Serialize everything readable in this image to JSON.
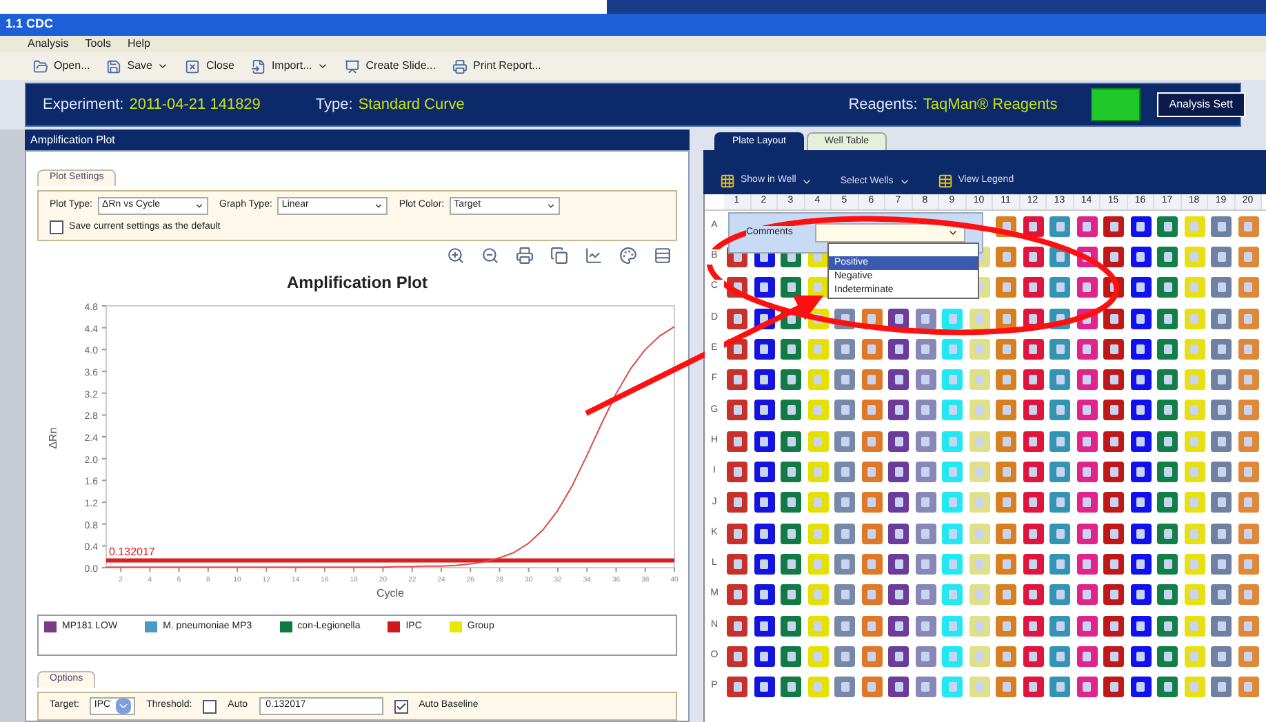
{
  "window": {
    "title": "1.1 CDC"
  },
  "menu": [
    "Analysis",
    "Tools",
    "Help"
  ],
  "toolbar": [
    {
      "label": "Open...",
      "kind": "open",
      "dropdown": false
    },
    {
      "label": "Save",
      "kind": "save",
      "dropdown": true
    },
    {
      "label": "Close",
      "kind": "close",
      "dropdown": false
    },
    {
      "label": "Import...",
      "kind": "import",
      "dropdown": true
    },
    {
      "label": "Create Slide...",
      "kind": "slide",
      "dropdown": false
    },
    {
      "label": "Print Report...",
      "kind": "print",
      "dropdown": false
    }
  ],
  "experiment_bar": {
    "fields": [
      {
        "label": "Experiment:",
        "value": "2011-04-21 141829"
      },
      {
        "label": "Type:",
        "value": "Standard Curve"
      },
      {
        "label": "Reagents:",
        "value": "TaqMan® Reagents"
      }
    ],
    "buttons": [
      {
        "kind": "status"
      },
      {
        "kind": "text",
        "label": "Analysis Sett"
      }
    ]
  },
  "amplification_panel": {
    "title": "Amplification Plot",
    "plot_settings": {
      "tab": "Plot Settings",
      "fields": [
        {
          "label": "Plot Type:",
          "value": "ΔRn vs Cycle"
        },
        {
          "label": "Graph Type:",
          "value": "Linear"
        },
        {
          "label": "Plot Color:",
          "value": "Target"
        }
      ],
      "save_default": {
        "label": "Save current settings as the default",
        "checked": false
      }
    },
    "chart_data": {
      "type": "line",
      "title": "Amplification Plot",
      "xlabel": "Cycle",
      "ylabel": "ΔRn",
      "ref_lines": [
        {
          "axis": "y",
          "value": 0.132017,
          "label": "0.132017",
          "color": "#d82020"
        }
      ],
      "xticks": [
        2,
        4,
        6,
        8,
        10,
        12,
        14,
        16,
        18,
        20,
        22,
        24,
        26,
        28,
        30,
        32,
        34,
        36,
        38,
        40
      ],
      "x": [
        1,
        2,
        3,
        4,
        5,
        6,
        7,
        8,
        9,
        10,
        11,
        12,
        13,
        14,
        15,
        16,
        17,
        18,
        19,
        20,
        21,
        22,
        23,
        24,
        25,
        26,
        27,
        28,
        29,
        30,
        31,
        32,
        33,
        34,
        35,
        36,
        37,
        38,
        39,
        40
      ],
      "series": [
        {
          "color": "#e04848",
          "values": [
            0.01,
            0.01,
            0.01,
            0.01,
            0.01,
            0.01,
            0.01,
            0.01,
            0.01,
            0.01,
            0.01,
            0.01,
            0.01,
            0.01,
            0.01,
            0.01,
            0.01,
            0.01,
            0.01,
            0.01,
            0.02,
            0.02,
            0.03,
            0.03,
            0.04,
            0.07,
            0.11,
            0.18,
            0.28,
            0.45,
            0.7,
            1.05,
            1.51,
            2.06,
            2.64,
            3.19,
            3.65,
            4.0,
            4.25,
            4.42
          ]
        }
      ],
      "xlim": [
        1,
        40
      ],
      "ylim": [
        0,
        4.8
      ],
      "yticks": [
        {
          "value": 0,
          "label": "0.0"
        },
        0.4,
        0.8,
        1.2,
        1.6,
        {
          "value": 2,
          "label": "2.0"
        },
        2.4,
        2.8,
        3.2,
        3.6,
        {
          "value": 4,
          "label": "4.0"
        },
        4.4,
        4.8
      ]
    },
    "legend": [
      {
        "label": "MP181 LOW",
        "color": "#7a3a8a"
      },
      {
        "label": "M. pneumoniae MP3",
        "color": "#4a9ac8"
      },
      {
        "label": "con-Legionella",
        "color": "#0a7a40"
      },
      {
        "label": "IPC",
        "color": "#d01818"
      },
      {
        "label": "Group",
        "color": "#e8e800"
      }
    ],
    "options": {
      "tab": "Options",
      "target": {
        "label": "Target:",
        "value": "IPC"
      },
      "threshold": {
        "label": "Threshold:",
        "value": "0.132017"
      },
      "auto": {
        "label": "Auto",
        "checked": false
      },
      "auto_baseline": {
        "label": "Auto Baseline",
        "checked": true
      }
    }
  },
  "plate": {
    "tabs": [
      {
        "label": "Plate Layout",
        "selected": true
      },
      {
        "label": "Well Table",
        "selected": false
      }
    ],
    "toolbar": [
      {
        "label": "Show in Well",
        "kind": "menu"
      },
      {
        "label": "Select Wells",
        "kind": "menu"
      },
      {
        "label": "View Legend",
        "kind": "legend"
      }
    ],
    "columns": [
      {
        "label": "1",
        "color": "#c8302a"
      },
      {
        "label": "2",
        "color": "#1414e0"
      },
      {
        "label": "3",
        "color": "#127a44"
      },
      {
        "label": "4",
        "color": "#e6e000"
      },
      {
        "label": "5",
        "color": "#7888a8"
      },
      {
        "label": "6",
        "color": "#e07828"
      },
      {
        "label": "7",
        "color": "#6c3c9c"
      },
      {
        "label": "8",
        "color": "#8888b8"
      },
      {
        "label": "9",
        "color": "#22e8f4"
      },
      {
        "label": "10",
        "color": "#e0e088"
      },
      {
        "label": "11",
        "color": "#d88020"
      },
      {
        "label": "12",
        "color": "#e0143c"
      },
      {
        "label": "13",
        "color": "#3494b4"
      },
      {
        "label": "14",
        "color": "#e0248c"
      },
      {
        "label": "15",
        "color": "#c01818"
      },
      {
        "label": "16",
        "color": "#1010f0"
      },
      {
        "label": "17",
        "color": "#108048"
      },
      {
        "label": "18",
        "color": "#e8e010"
      },
      {
        "label": "19",
        "color": "#7080a0"
      },
      {
        "label": "20",
        "color": "#e08838"
      }
    ],
    "rows": [
      "A",
      "B",
      "C",
      "D",
      "E",
      "F",
      "G",
      "H",
      "I",
      "J",
      "K",
      "L",
      "M",
      "N",
      "O",
      "P"
    ],
    "popup": {
      "label": "Comments",
      "options": [
        {
          "label": "Positive",
          "selected": true
        },
        {
          "label": "Negative",
          "selected": false
        },
        {
          "label": "Indeterminate",
          "selected": false
        }
      ]
    }
  },
  "annotation": {
    "kind": "circle-and-arrow"
  }
}
